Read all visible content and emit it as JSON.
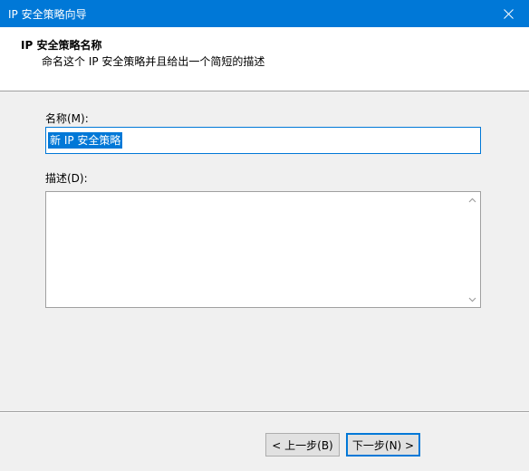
{
  "window": {
    "title": "IP 安全策略向导",
    "close_icon": "close-icon"
  },
  "header": {
    "title": "IP 安全策略名称",
    "subtitle": "命名这个 IP 安全策略并且给出一个简短的描述"
  },
  "form": {
    "name_label": "名称(M):",
    "name_value": "新 IP 安全策略",
    "description_label": "描述(D):",
    "description_value": ""
  },
  "buttons": {
    "back_label": "< 上一步(B)",
    "next_label": "下一步(N) >"
  },
  "colors": {
    "accent": "#0078d7",
    "dialog_bg": "#f0f0f0"
  }
}
